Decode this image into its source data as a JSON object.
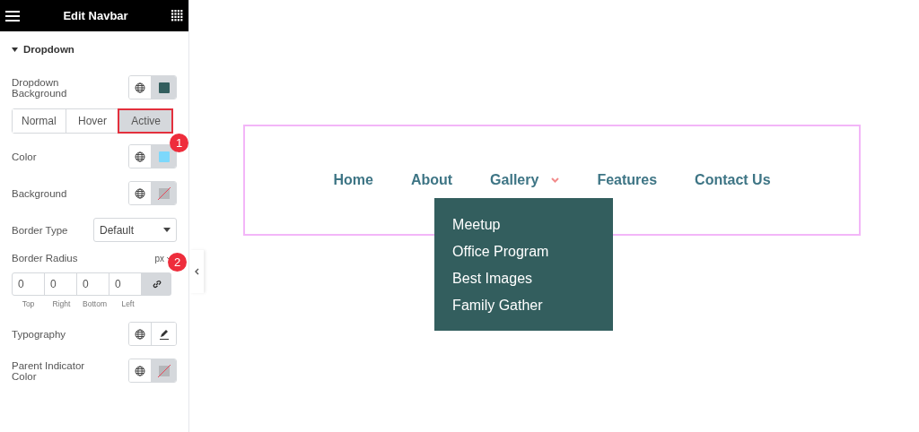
{
  "panel": {
    "title": "Edit Navbar"
  },
  "section": {
    "title": "Dropdown",
    "expanded": true
  },
  "fields": [
    {
      "kind": "color",
      "label": "Dropdown Background",
      "color": "#335e5e"
    },
    {
      "kind": "tabs",
      "tabs": [
        {
          "label": "Normal",
          "selected": false
        },
        {
          "label": "Hover",
          "selected": false
        },
        {
          "label": "Active",
          "selected": true,
          "highlighted": true
        }
      ]
    },
    {
      "kind": "color",
      "label": "Color",
      "color": "#7dd8fb",
      "badge": "1"
    },
    {
      "kind": "unset",
      "label": "Background"
    },
    {
      "kind": "select",
      "label": "Border Type",
      "value": "Default"
    },
    {
      "kind": "dimensions",
      "label": "Border Radius",
      "unit": "px",
      "badge": "2",
      "values": [
        "0",
        "0",
        "0",
        "0"
      ],
      "sides": [
        "Top",
        "Right",
        "Bottom",
        "Left"
      ]
    },
    {
      "kind": "typography",
      "label": "Typography"
    },
    {
      "kind": "unset",
      "label": "Parent Indicator Color"
    }
  ],
  "navbar": {
    "items": [
      {
        "label": "Home",
        "has_dropdown": false
      },
      {
        "label": "About",
        "has_dropdown": false
      },
      {
        "label": "Gallery",
        "has_dropdown": true,
        "expanded": true,
        "children": [
          "Meetup",
          "Office Program",
          "Best Images",
          "Family Gather"
        ]
      },
      {
        "label": "Features",
        "has_dropdown": false
      },
      {
        "label": "Contact Us",
        "has_dropdown": false
      }
    ]
  }
}
